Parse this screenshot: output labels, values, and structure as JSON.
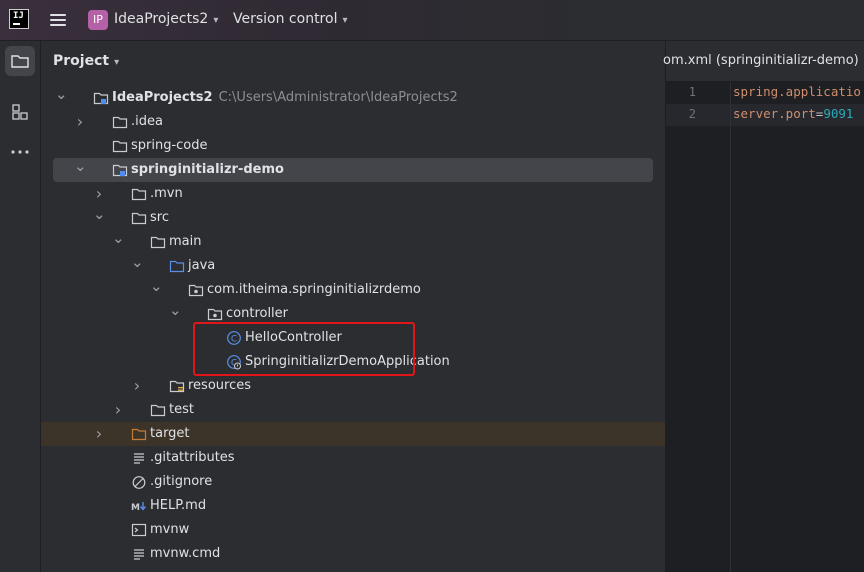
{
  "titlebar": {
    "logo_text": "IJ",
    "project_badge": "IP",
    "project_name": "IdeaProjects2",
    "vcs_label": "Version control"
  },
  "panel": {
    "title": "Project"
  },
  "tree": [
    {
      "label": "IdeaProjects2",
      "hint": "C:\\Users\\Administrator\\IdeaProjects2",
      "icon": "module-folder-icon",
      "arrow": "down",
      "bold": true
    },
    {
      "label": ".idea",
      "icon": "folder-icon",
      "arrow": "right"
    },
    {
      "label": "spring-code",
      "icon": "folder-icon",
      "arrow": ""
    },
    {
      "label": "springinitializr-demo",
      "icon": "module-folder-icon",
      "arrow": "down",
      "bold": true,
      "selected": true
    },
    {
      "label": ".mvn",
      "icon": "folder-icon",
      "arrow": "right"
    },
    {
      "label": "src",
      "icon": "folder-icon",
      "arrow": "down"
    },
    {
      "label": "main",
      "icon": "folder-icon",
      "arrow": "down"
    },
    {
      "label": "java",
      "icon": "source-folder-icon",
      "arrow": "down"
    },
    {
      "label": "com.itheima.springinitializrdemo",
      "icon": "package-icon",
      "arrow": "down"
    },
    {
      "label": "controller",
      "icon": "package-icon",
      "arrow": "down"
    },
    {
      "label": "HelloController",
      "icon": "class-icon",
      "arrow": ""
    },
    {
      "label": "SpringinitializrDemoApplication",
      "icon": "spring-boot-class-icon",
      "arrow": ""
    },
    {
      "label": "resources",
      "icon": "resources-folder-icon",
      "arrow": "right"
    },
    {
      "label": "test",
      "icon": "folder-icon",
      "arrow": "right"
    },
    {
      "label": "target",
      "icon": "excluded-folder-icon",
      "arrow": "right",
      "excluded": true
    },
    {
      "label": ".gitattributes",
      "icon": "text-file-icon",
      "arrow": ""
    },
    {
      "label": ".gitignore",
      "icon": "ignore-file-icon",
      "arrow": ""
    },
    {
      "label": "HELP.md",
      "icon": "markdown-file-icon",
      "arrow": ""
    },
    {
      "label": "mvnw",
      "icon": "shell-script-icon",
      "arrow": ""
    },
    {
      "label": "mvnw.cmd",
      "icon": "text-file-icon",
      "arrow": ""
    }
  ],
  "editor": {
    "tab_title": "om.xml (springinitializr-demo)",
    "lines": [
      {
        "num": "1",
        "key": "spring.applicatio",
        "sep": "",
        "value": ""
      },
      {
        "num": "2",
        "key": "server.port",
        "sep": "=",
        "value": "9091"
      }
    ]
  },
  "colors": {
    "accent_badge": "#b561a8",
    "highlight_box": "#e0161a",
    "property_key": "#cf8e6d",
    "property_value": "#2aacb8",
    "folder_excluded": "#c77d3a",
    "source_folder": "#5a8ee8"
  }
}
